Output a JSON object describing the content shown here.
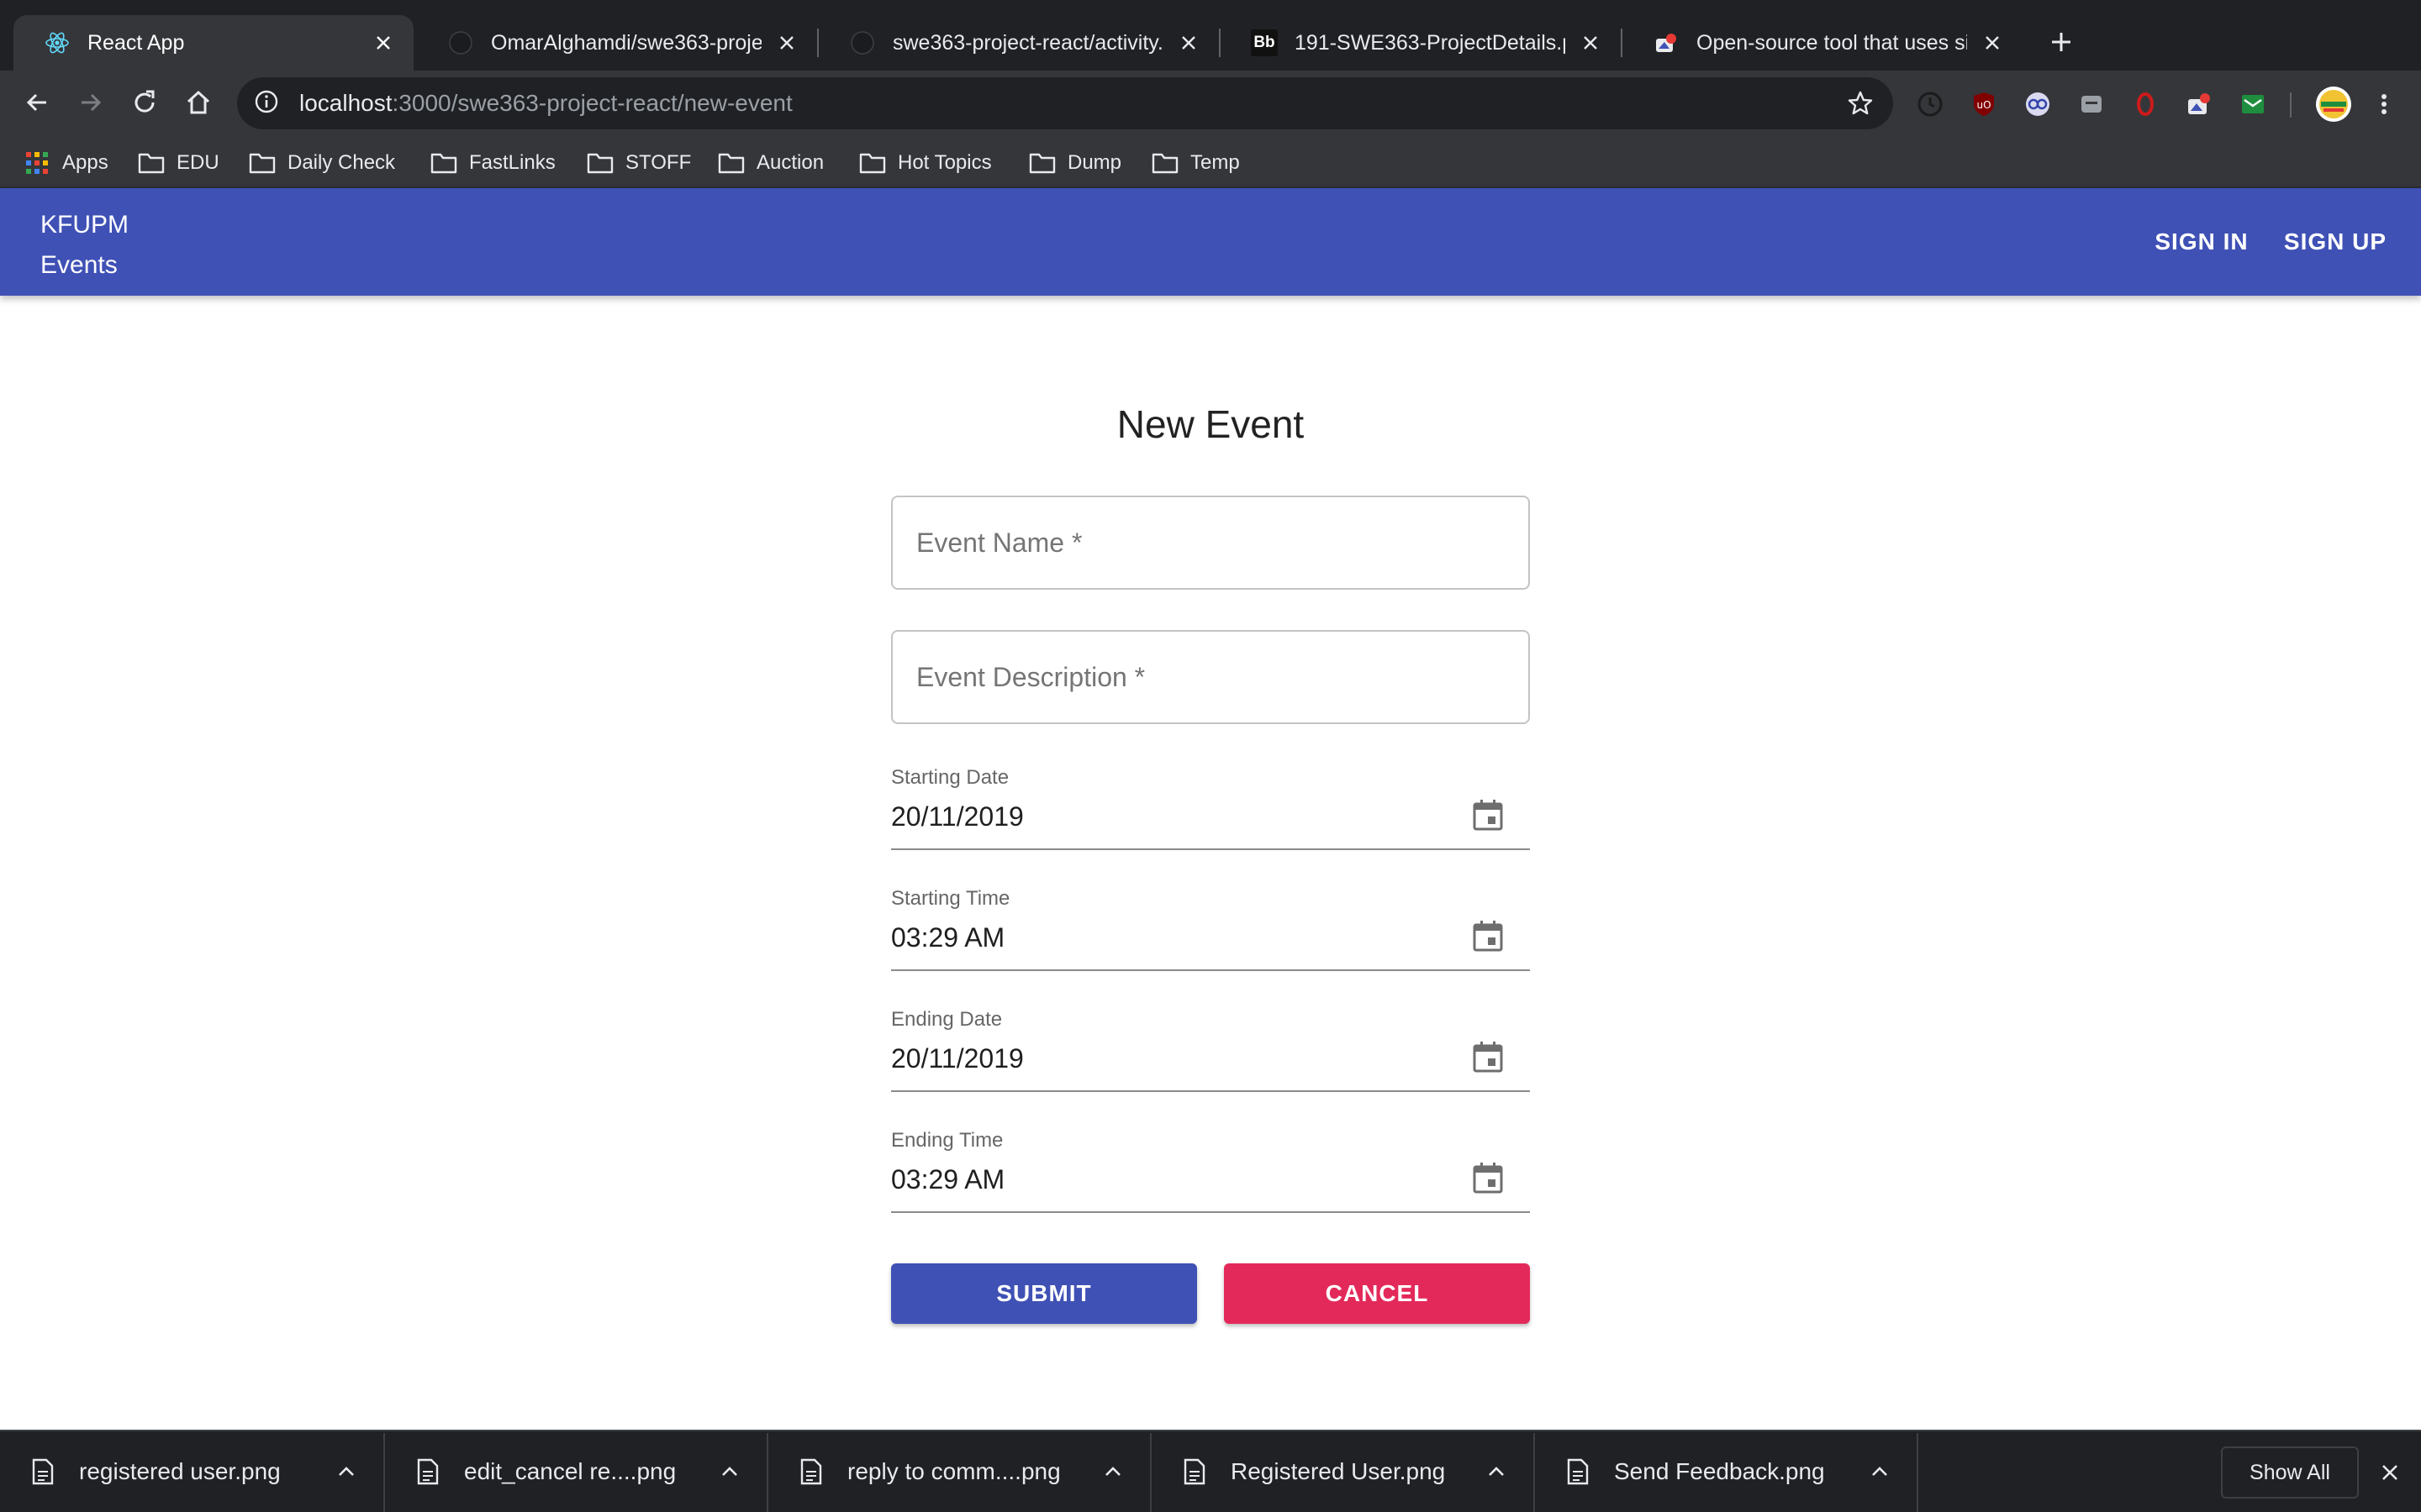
{
  "browser": {
    "tabs": [
      {
        "title": "React App",
        "active": true,
        "icon": "react-icon"
      },
      {
        "title": "OmarAlghamdi/swe363-project",
        "active": false,
        "icon": "github-icon"
      },
      {
        "title": "swe363-project-react/activity.",
        "active": false,
        "icon": "github-icon"
      },
      {
        "title": "191-SWE363-ProjectDetails.pdf",
        "active": false,
        "icon": "blackboard-icon",
        "icon_text": "Bb"
      },
      {
        "title": "Open-source tool that uses sim",
        "active": false,
        "icon": "app-icon"
      }
    ],
    "address": {
      "host": "localhost",
      "path": ":3000/swe363-project-react/new-event"
    },
    "bookmarks": [
      {
        "label": "Apps",
        "icon": "apps-grid-icon"
      },
      {
        "label": "EDU",
        "icon": "folder-icon"
      },
      {
        "label": "Daily Check",
        "icon": "folder-icon"
      },
      {
        "label": "FastLinks",
        "icon": "folder-icon"
      },
      {
        "label": "STOFF",
        "icon": "folder-icon"
      },
      {
        "label": "Auction",
        "icon": "folder-icon"
      },
      {
        "label": "Hot Topics",
        "icon": "folder-icon"
      },
      {
        "label": "Dump",
        "icon": "folder-icon"
      },
      {
        "label": "Temp",
        "icon": "folder-icon"
      }
    ],
    "downloads": [
      {
        "name": "registered user.png"
      },
      {
        "name": "edit_cancel re....png"
      },
      {
        "name": "reply to comm....png"
      },
      {
        "name": "Registered User.png"
      },
      {
        "name": "Send Feedback.png"
      }
    ],
    "show_all_label": "Show All"
  },
  "app": {
    "brand_line1": "KFUPM",
    "brand_line2": "Events",
    "sign_in": "SIGN IN",
    "sign_up": "SIGN UP",
    "primary_color": "#3f51b5",
    "cancel_color": "#e3295a"
  },
  "form": {
    "title": "New Event",
    "event_name_placeholder": "Event Name *",
    "event_description_placeholder": "Event Description *",
    "starting_date": {
      "label": "Starting Date",
      "value": "20/11/2019"
    },
    "starting_time": {
      "label": "Starting Time",
      "value": "03:29 AM"
    },
    "ending_date": {
      "label": "Ending Date",
      "value": "20/11/2019"
    },
    "ending_time": {
      "label": "Ending Time",
      "value": "03:29 AM"
    },
    "submit_label": "SUBMIT",
    "cancel_label": "CANCEL"
  }
}
